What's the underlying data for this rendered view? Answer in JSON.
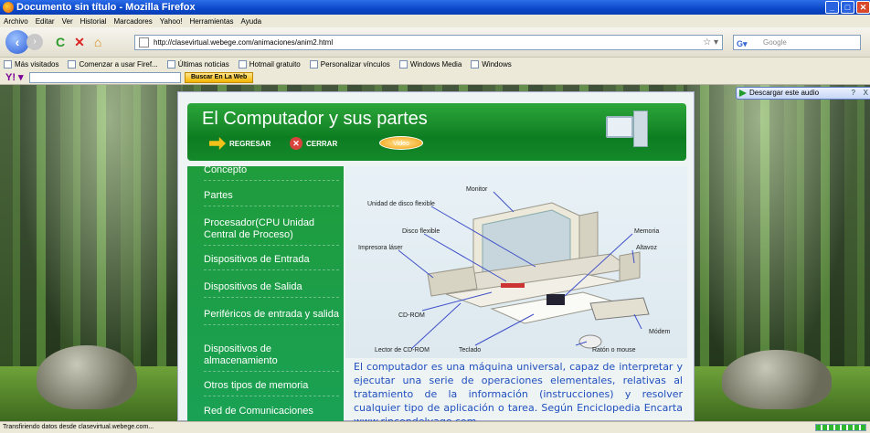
{
  "window": {
    "title": "Documento sin título - Mozilla Firefox"
  },
  "menu": {
    "items": [
      "Archivo",
      "Editar",
      "Ver",
      "Historial",
      "Marcadores",
      "Yahoo!",
      "Herramientas",
      "Ayuda"
    ]
  },
  "nav": {
    "url": "http://clasevirtual.webege.com/animaciones/anim2.html",
    "search_placeholder": "Google"
  },
  "bookmarks": {
    "items": [
      "Más visitados",
      "Comenzar a usar Firef...",
      "Últimas noticias",
      "Hotmail gratuito",
      "Personalizar vínculos",
      "Windows Media",
      "Windows"
    ]
  },
  "yahoo": {
    "search_button": "Buscar En La Web"
  },
  "page": {
    "audio_button": "Descargar este audio",
    "audio_help": "?",
    "audio_close": "X",
    "title": "El Computador y sus partes",
    "back_label": "REGRESAR",
    "close_label": "CERRAR",
    "video_label": "Video",
    "menu_items": [
      "Concepto",
      "Partes",
      "Procesador(CPU Unidad Central de Proceso)",
      "Dispositivos de Entrada",
      "Dispositivos de Salida",
      "Periféricos de entrada y salida",
      "Dispositivos de almacenamiento",
      "Otros tipos de memoria",
      "Red de Comunicaciones"
    ],
    "figure_labels": {
      "monitor": "Monitor",
      "floppy_unit": "Unidad de disco flexible",
      "floppy_disk": "Disco flexible",
      "memory": "Memoria",
      "printer": "Impresora láser",
      "speaker": "Altavoz",
      "cdrom": "CD-ROM",
      "modem": "Módem",
      "cd_reader": "Lector de CD-ROM",
      "keyboard": "Teclado",
      "mouse": "Ratón o mouse"
    },
    "description": "El computador es una máquina universal, capaz de interpretar y ejecutar una serie de operaciones elementales, relativas al tratamiento de la información (instrucciones) y resolver cualquier tipo de aplicación o tarea. Según Enciclopedia Encarta www.rincondelvago.com"
  },
  "status": {
    "text": "Transfiriendo datos desde clasevirtual.webege.com..."
  }
}
